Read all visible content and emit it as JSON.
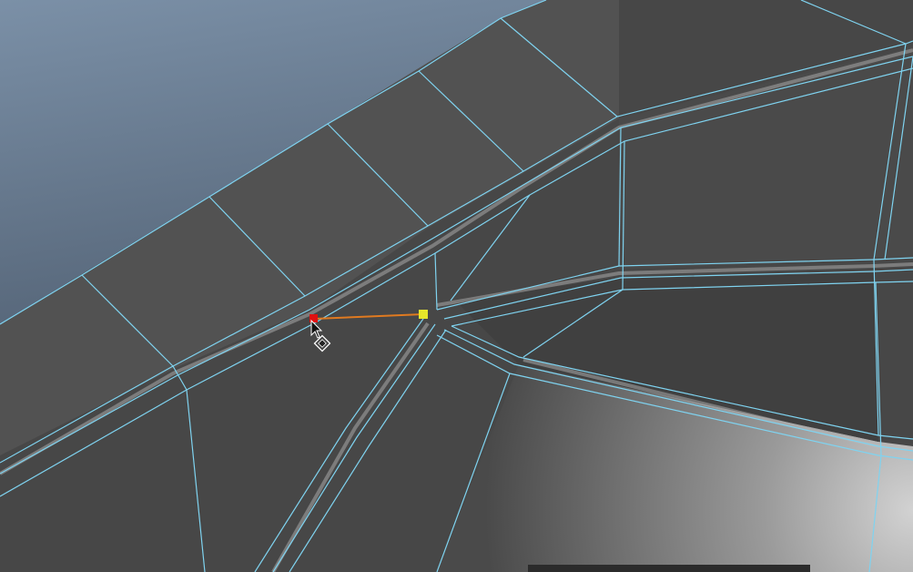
{
  "app": {
    "window": "3d-modeling-viewport",
    "view": "perspective",
    "display_mode": "wireframe-on-shaded"
  },
  "colors": {
    "background_top": "#7a8fa6",
    "background_bottom": "#3c4858",
    "mesh_wire": "#7fd3f0",
    "face_dark": "#414141",
    "face_mid": "#4f4f4f",
    "highlight": "#c9c9c9",
    "snap_start_vertex": "#e01010",
    "snap_target_vertex": "#e6e62a",
    "snap_line": "#e07a20"
  },
  "tool": {
    "name": "multi-cut",
    "cursor_icon": "arrow-cursor-icon",
    "move_icon": "move-handle-icon"
  }
}
